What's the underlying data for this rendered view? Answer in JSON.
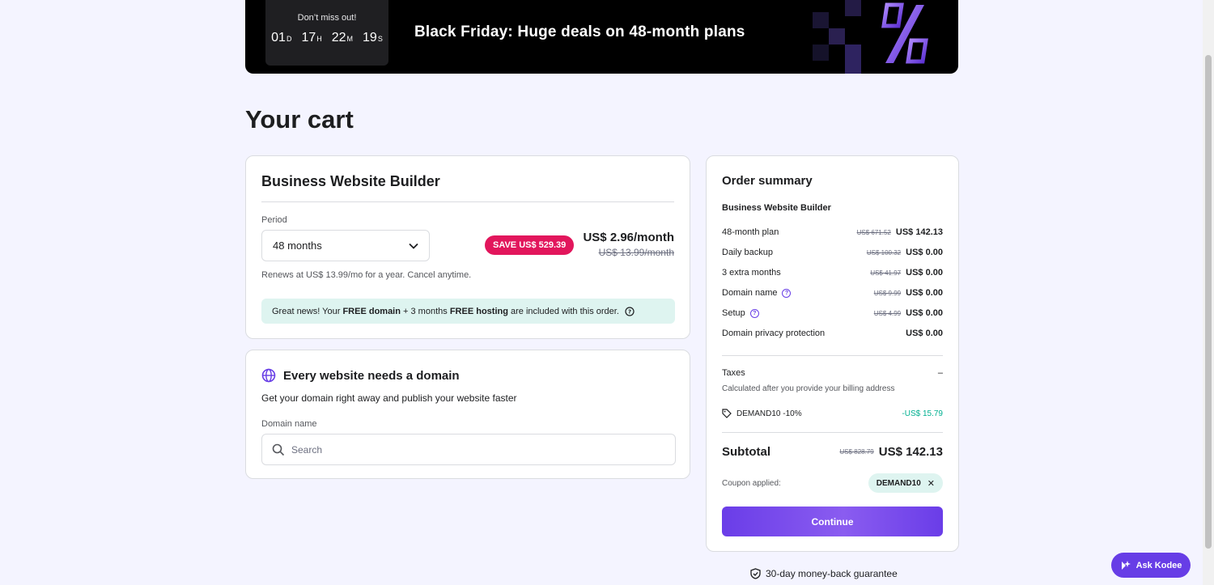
{
  "banner": {
    "timer_title": "Don’t miss out!",
    "timer": [
      {
        "value": "01",
        "unit": "D"
      },
      {
        "value": "17",
        "unit": "H"
      },
      {
        "value": "22",
        "unit": "M"
      },
      {
        "value": "19",
        "unit": "S"
      }
    ],
    "headline": "Black Friday: Huge deals on 48-month plans"
  },
  "page_title": "Your cart",
  "product": {
    "title": "Business Website Builder",
    "period_label": "Period",
    "period_value": "48 months",
    "save_badge": "SAVE US$ 529.39",
    "price": "US$ 2.96/month",
    "old_price": "US$ 13.99/month",
    "renews": "Renews at US$ 13.99/mo for a year. Cancel anytime.",
    "note": {
      "prefix": "Great news! Your ",
      "bold1": "FREE domain",
      "middle": " + 3 months ",
      "bold2": "FREE hosting",
      "suffix": " are included with this order."
    }
  },
  "domain": {
    "title": "Every website needs a domain",
    "subtitle": "Get your domain right away and publish your website faster",
    "label": "Domain name",
    "placeholder": "Search"
  },
  "summary": {
    "title": "Order summary",
    "product": "Business Website Builder",
    "rows": [
      {
        "label": "48-month plan",
        "old": "US$ 671.52",
        "new": "US$ 142.13",
        "help": false
      },
      {
        "label": "Daily backup",
        "old": "US$ 100.32",
        "new": "US$ 0.00",
        "help": false
      },
      {
        "label": "3 extra months",
        "old": "US$ 41.97",
        "new": "US$ 0.00",
        "help": false
      },
      {
        "label": "Domain name",
        "old": "US$ 9.99",
        "new": "US$ 0.00",
        "help": true
      },
      {
        "label": "Setup",
        "old": "US$ 4.99",
        "new": "US$ 0.00",
        "help": true
      },
      {
        "label": "Domain privacy protection",
        "old": "",
        "new": "US$ 0.00",
        "help": false
      }
    ],
    "taxes_label": "Taxes",
    "taxes_value": "–",
    "taxes_note": "Calculated after you provide your billing address",
    "coupon_label": "DEMAND10 -10%",
    "coupon_discount": "-US$ 15.79",
    "subtotal_label": "Subtotal",
    "subtotal_old": "US$ 828.79",
    "subtotal_new": "US$ 142.13",
    "applied_label": "Coupon applied:",
    "applied_code": "DEMAND10",
    "continue_label": "Continue"
  },
  "guarantee": "30-day money-back guarantee",
  "ask_label": "Ask Kodee",
  "colors": {
    "accent": "#673de6",
    "badge": "#e2165c",
    "success": "#00b090",
    "note_bg": "#def4f0"
  }
}
